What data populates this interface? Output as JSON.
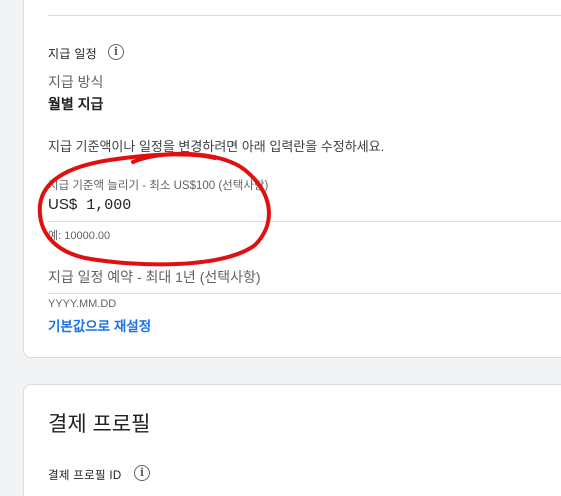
{
  "payment_schedule": {
    "section_label": "지급 일정",
    "method_label": "지급 방식",
    "method_value": "월별 지급",
    "help_text": "지급 기준액이나 일정을 변경하려면 아래 입력란을 수정하세요.",
    "threshold_field": {
      "label": "지급 기준액 늘리기 - 최소 US$100 (선택사항)",
      "currency": "US$",
      "value": "1,000",
      "example": "예: 10000.00"
    },
    "schedule_field": {
      "label": "지급 일정 예약 - 최대 1년 (선택사항)",
      "placeholder": "YYYY.MM.DD"
    },
    "reset_link": "기본값으로 재설정"
  },
  "payment_profile": {
    "title": "결제 프로필",
    "id_label": "결제 프로필 ID"
  },
  "icons": {
    "info": "info-icon"
  },
  "colors": {
    "link": "#1a73e8",
    "annotation": "#e01010"
  }
}
